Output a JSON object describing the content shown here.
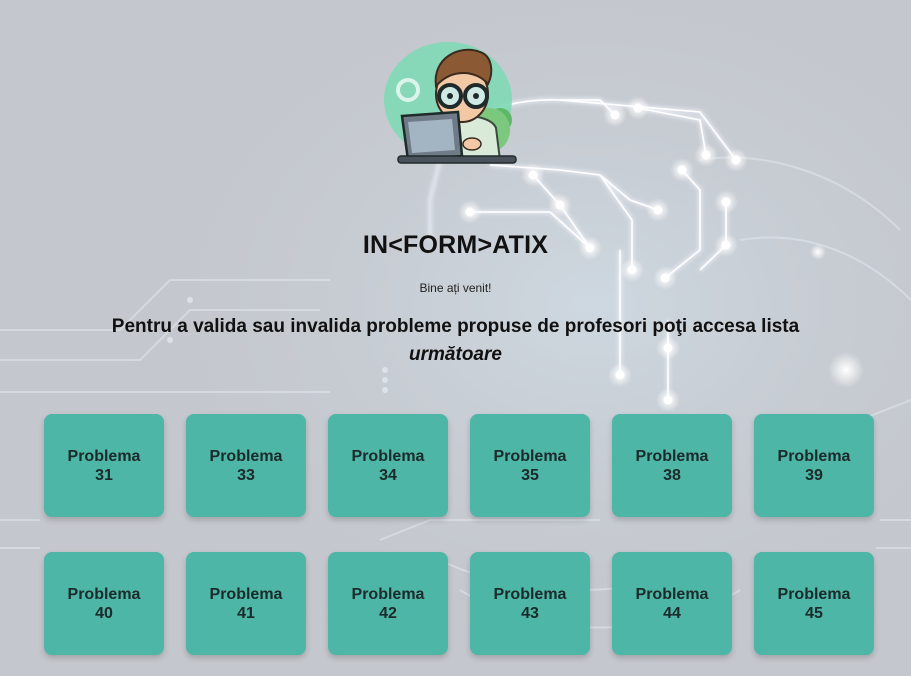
{
  "header": {
    "title": "IN<FORM>ATIX",
    "welcome": "Bine ați venit!",
    "intro_main": "Pentru a valida sau invalida probleme propuse de profesori poţi accesa lista",
    "intro_emphasis": "următoare"
  },
  "logo": {
    "icon": "programmer-mascot-icon"
  },
  "problems": [
    {
      "label": "Problema",
      "number": "31"
    },
    {
      "label": "Problema",
      "number": "33"
    },
    {
      "label": "Problema",
      "number": "34"
    },
    {
      "label": "Problema",
      "number": "35"
    },
    {
      "label": "Problema",
      "number": "38"
    },
    {
      "label": "Problema",
      "number": "39"
    },
    {
      "label": "Problema",
      "number": "40"
    },
    {
      "label": "Problema",
      "number": "41"
    },
    {
      "label": "Problema",
      "number": "42"
    },
    {
      "label": "Problema",
      "number": "43"
    },
    {
      "label": "Problema",
      "number": "44"
    },
    {
      "label": "Problema",
      "number": "45"
    }
  ],
  "colors": {
    "card": "#4db6a6",
    "background": "#c3c6cc",
    "circuit_glow": "#ffffff"
  }
}
